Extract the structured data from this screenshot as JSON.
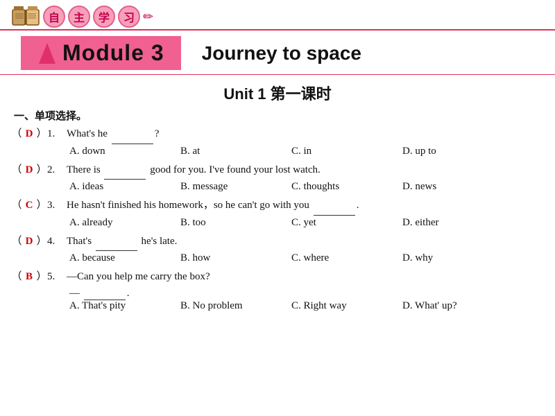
{
  "header": {
    "zizhu_chars": [
      "自",
      "主",
      "学",
      "习"
    ],
    "pink_line": true
  },
  "module": {
    "module_label": "Module 3",
    "subtitle": "Journey to space"
  },
  "unit": {
    "title": "Unit 1   第一课时"
  },
  "section": {
    "label": "一、单项选择。"
  },
  "questions": [
    {
      "num": "1.",
      "answer": "D",
      "text": "What's he",
      "blank": true,
      "after": "?",
      "options": [
        "A. down",
        "B. at",
        "C. in",
        "D. up to"
      ]
    },
    {
      "num": "2.",
      "answer": "D",
      "text": "There is",
      "blank": true,
      "after": "good for you. I've found your lost watch.",
      "options": [
        "A. ideas",
        "B. message",
        "C. thoughts",
        "D. news"
      ]
    },
    {
      "num": "3.",
      "answer": "C",
      "text": "He hasn't finished his homework，so he can't go with you",
      "blank": true,
      "after": ".",
      "options": [
        "A. already",
        "B. too",
        "C. yet",
        "D. either"
      ]
    },
    {
      "num": "4.",
      "answer": "D",
      "text": "That's",
      "blank": true,
      "after": "he's late.",
      "options": [
        "A. because",
        "B. how",
        "C. where",
        "D. why"
      ]
    },
    {
      "num": "5.",
      "answer": "B",
      "text": "—Can you help me carry the box?",
      "dash_line": "—",
      "blank2": true,
      "after2": ".",
      "options": [
        "A. That's pity",
        "B. No problem",
        "C. Right way",
        "D. What' up?"
      ]
    }
  ]
}
